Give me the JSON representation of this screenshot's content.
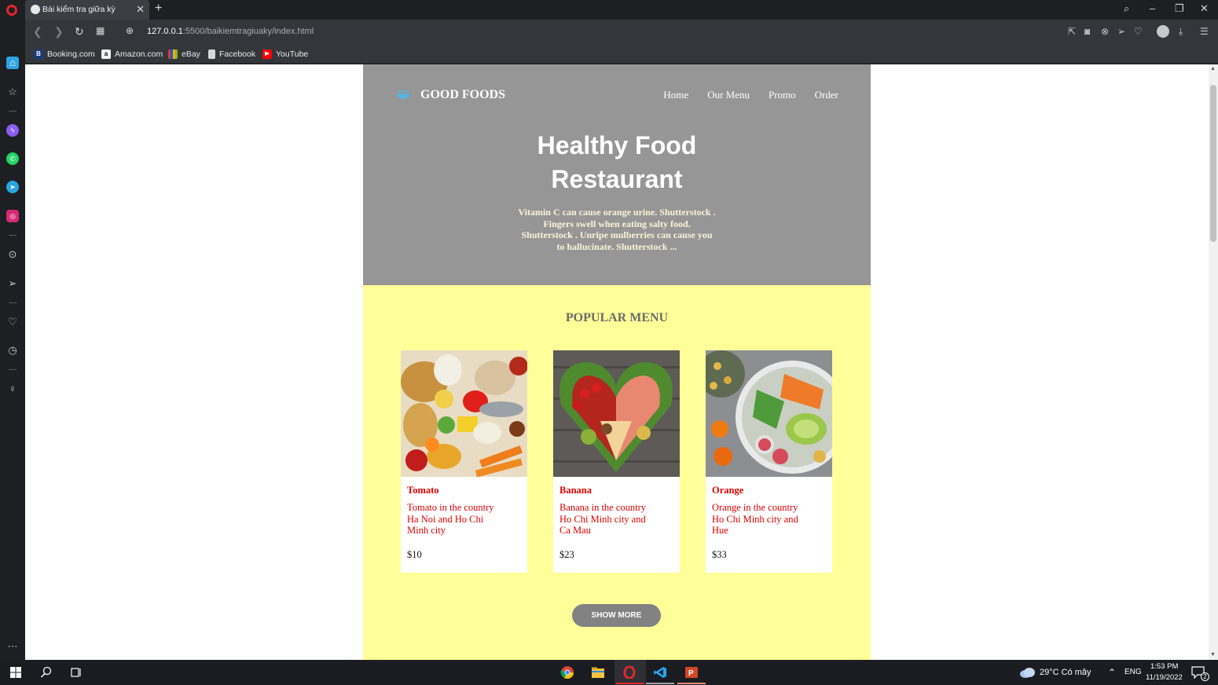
{
  "browser": {
    "tab_title": "Bài kiểm tra giữa kỳ",
    "url_host": "127.0.0.1",
    "url_path": ":5500/baikiemtragiuaky/index.html",
    "bookmarks": [
      "Booking.com",
      "Amazon.com",
      "eBay",
      "Facebook",
      "YouTube"
    ]
  },
  "site": {
    "brand": "GOOD FOODS",
    "nav": [
      "Home",
      "Our Menu",
      "Promo",
      "Order"
    ],
    "hero_title_line1": "Healthy Food",
    "hero_title_line2": "Restaurant",
    "hero_text": "Vitamin C can cause orange urine. Shutterstock . Fingers swell when eating salty food. Shutterstock . Unripe mulberries can cause you to hallucinate. Shutterstock ...",
    "menu_title": "POPULAR MENU",
    "cards": [
      {
        "name": "Tomato",
        "desc": "Tomato in the country Ha Noi and Ho Chi Minh city",
        "price": "$10"
      },
      {
        "name": "Banana",
        "desc": "Banana in the country Ho Chi Minh city and Ca Mau",
        "price": "$23"
      },
      {
        "name": "Orange",
        "desc": "Orange in the country Ho Chi Minh city and Hue",
        "price": "$33"
      }
    ],
    "show_more": "SHOW MORE"
  },
  "taskbar": {
    "weather": "29°C  Có mây",
    "lang": "ENG",
    "time": "1:53 PM",
    "date": "11/19/2022",
    "notifications": "2"
  },
  "colors": {
    "hero_bg": "#969696",
    "menu_bg": "#ffff99",
    "card_text": "#e30000",
    "button_bg": "#828282"
  }
}
